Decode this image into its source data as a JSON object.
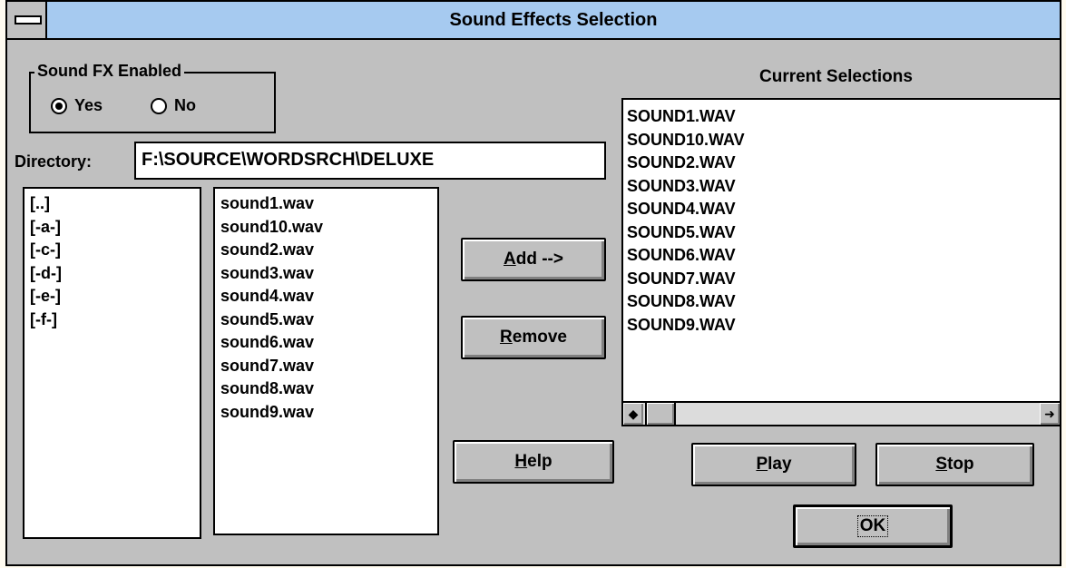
{
  "window": {
    "title": "Sound Effects Selection"
  },
  "sound_fx": {
    "group_label": "Sound FX Enabled",
    "options": [
      {
        "label": "Yes",
        "selected": true
      },
      {
        "label": "No",
        "selected": false
      }
    ]
  },
  "directory": {
    "label": "Directory:",
    "value": "F:\\SOURCE\\WORDSRCH\\DELUXE"
  },
  "drives_list": [
    "[..]",
    "[-a-]",
    "[-c-]",
    "[-d-]",
    "[-e-]",
    "[-f-]"
  ],
  "files_list": [
    "sound1.wav",
    "sound10.wav",
    "sound2.wav",
    "sound3.wav",
    "sound4.wav",
    "sound5.wav",
    "sound6.wav",
    "sound7.wav",
    "sound8.wav",
    "sound9.wav"
  ],
  "current_selections": {
    "label": "Current Selections",
    "items": [
      "SOUND1.WAV",
      "SOUND10.WAV",
      "SOUND2.WAV",
      "SOUND3.WAV",
      "SOUND4.WAV",
      "SOUND5.WAV",
      "SOUND6.WAV",
      "SOUND7.WAV",
      "SOUND8.WAV",
      "SOUND9.WAV"
    ]
  },
  "buttons": {
    "add": {
      "mnemonic": "A",
      "rest": "dd -->"
    },
    "remove": {
      "mnemonic": "R",
      "rest": "emove"
    },
    "help": {
      "mnemonic": "H",
      "rest": "elp"
    },
    "play": {
      "mnemonic": "P",
      "rest": "lay"
    },
    "stop": {
      "mnemonic": "S",
      "rest": "top"
    },
    "ok": {
      "label": "OK"
    }
  },
  "scrollbar": {
    "left_arrow": "◆",
    "right_arrow": "➜"
  }
}
